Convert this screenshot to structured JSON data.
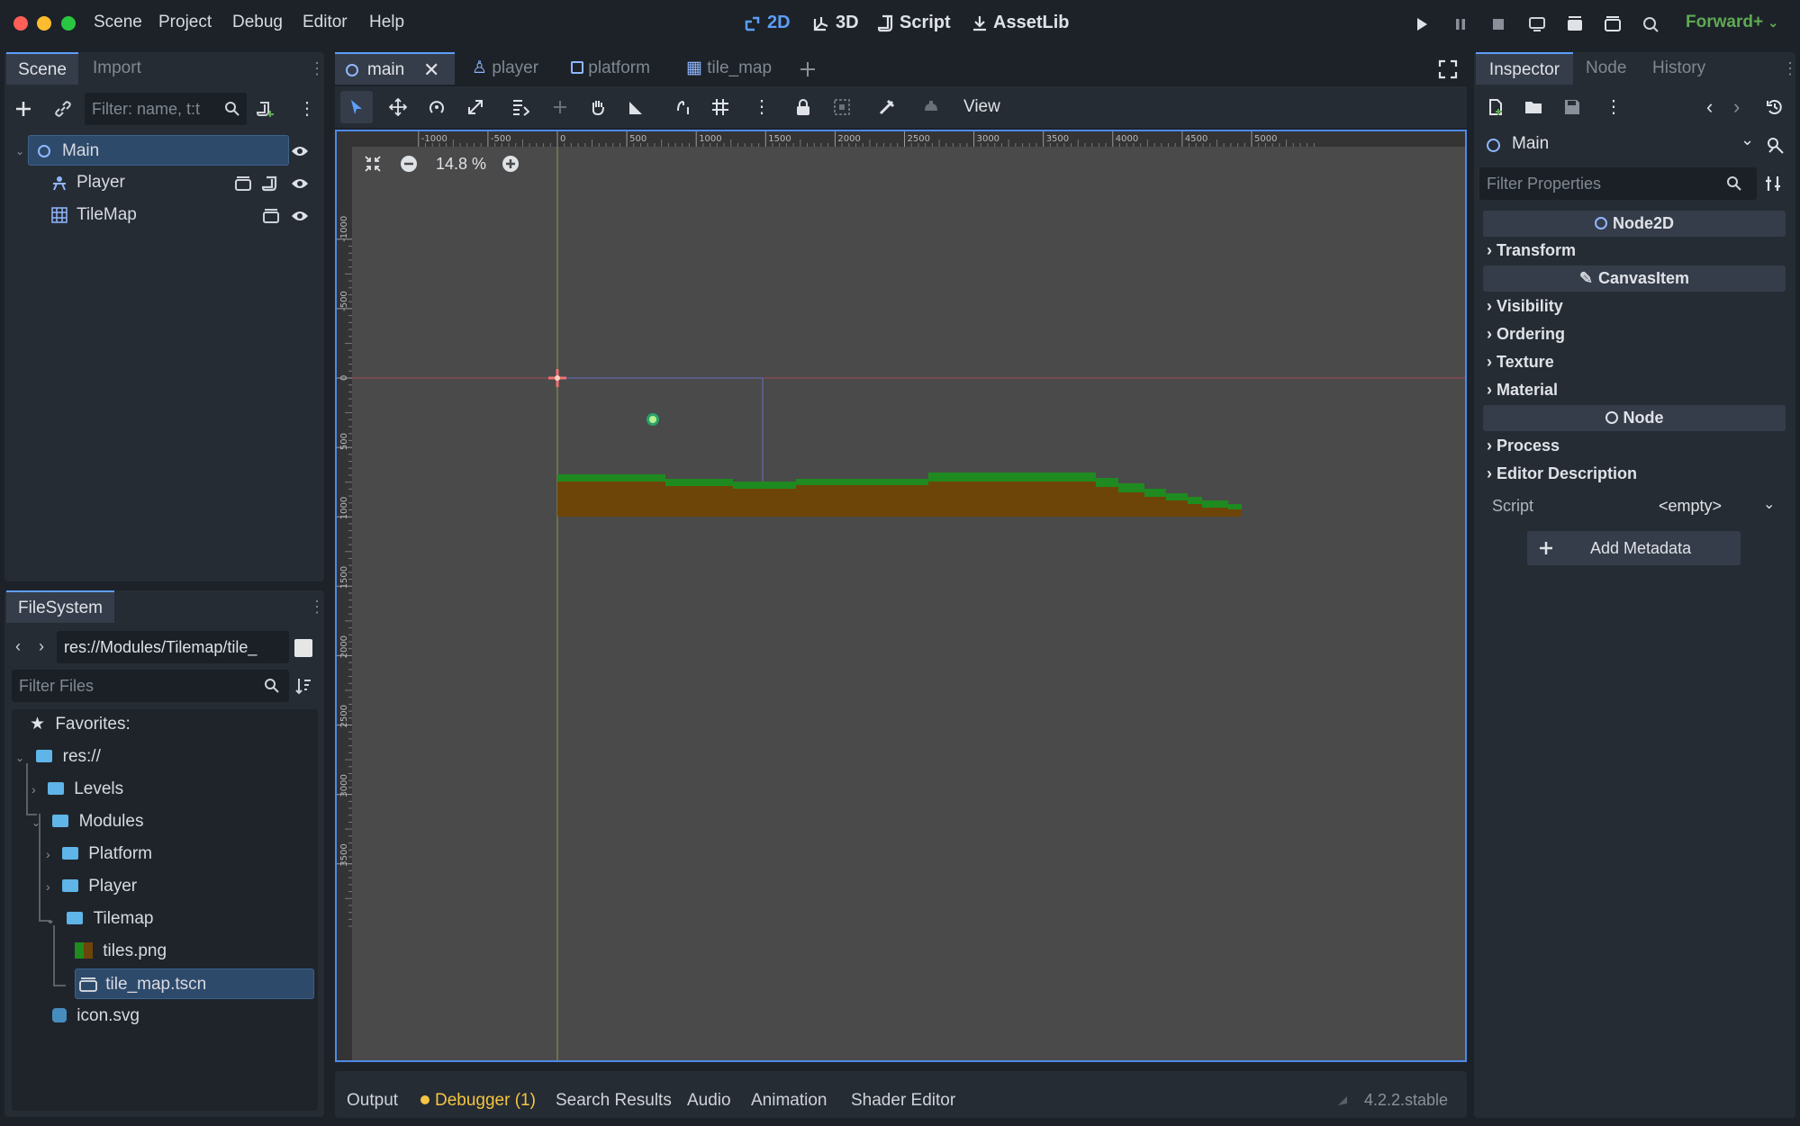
{
  "menu": [
    "Scene",
    "Project",
    "Debug",
    "Editor",
    "Help"
  ],
  "modes": {
    "d2": "2D",
    "d3": "3D",
    "script": "Script",
    "assetlib": "AssetLib"
  },
  "renderer": "Forward+",
  "scene_dock": {
    "tabs": [
      "Scene",
      "Import"
    ],
    "filter_placeholder": "Filter: name, t:t",
    "nodes": [
      {
        "name": "Main",
        "icon": "node2d-icon"
      },
      {
        "name": "Player",
        "icon": "character-icon"
      },
      {
        "name": "TileMap",
        "icon": "tilemap-icon"
      }
    ]
  },
  "filesystem": {
    "tab": "FileSystem",
    "path": "res://Modules/Tilemap/tile_",
    "filter_placeholder": "Filter Files",
    "favorites": "Favorites:",
    "items": [
      "res://",
      "Levels",
      "Modules",
      "Platform",
      "Player",
      "Tilemap",
      "tiles.png",
      "tile_map.tscn",
      "icon.svg"
    ]
  },
  "editor_tabs": [
    "main",
    "player",
    "platform",
    "tile_map"
  ],
  "toolbar": {
    "view": "View"
  },
  "zoom": "14.8 %",
  "ruler": {
    "h": [
      "-1000",
      "-500",
      "0",
      "500",
      "1000",
      "1500",
      "2000",
      "2500",
      "3000",
      "3500",
      "4000",
      "4500",
      "5000"
    ],
    "v": [
      "-1000",
      "-500",
      "0",
      "500",
      "1000",
      "1500",
      "2000",
      "2500",
      "3000",
      "3500"
    ]
  },
  "inspector": {
    "tabs": [
      "Inspector",
      "Node",
      "History"
    ],
    "node": "Main",
    "filter_placeholder": "Filter Properties",
    "sections": {
      "node2d": "Node2D",
      "transform": "Transform",
      "canvasitem": "CanvasItem",
      "visibility": "Visibility",
      "ordering": "Ordering",
      "texture": "Texture",
      "material": "Material",
      "node": "Node",
      "process": "Process",
      "editor_description": "Editor Description"
    },
    "script_label": "Script",
    "script_value": "<empty>",
    "add_metadata": "Add Metadata"
  },
  "bottom": {
    "tabs": {
      "output": "Output",
      "debugger": "Debugger (1)",
      "search": "Search Results",
      "audio": "Audio",
      "animation": "Animation",
      "shader": "Shader Editor"
    },
    "version": "4.2.2.stable"
  },
  "colors": {
    "accent": "#5d9ef8",
    "grass": "#1f8a1f",
    "dirt": "#6e4508",
    "viewport": "#4a4a4a",
    "warning": "#f5c542"
  }
}
